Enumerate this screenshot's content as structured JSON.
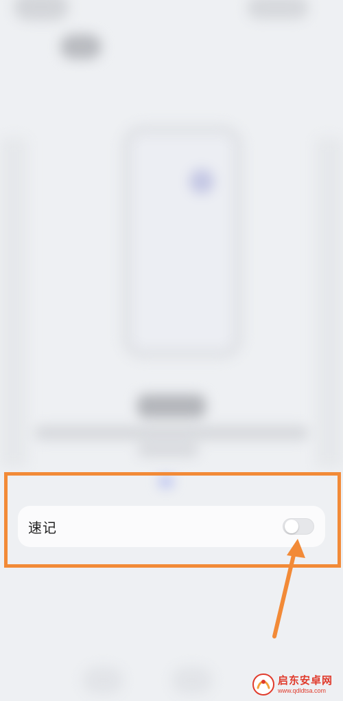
{
  "setting": {
    "label": "速记",
    "toggle_on": false
  },
  "watermark": {
    "name": "启东安卓网",
    "url": "www.qdldtsa.com"
  },
  "colors": {
    "highlight": "#f28a37",
    "toggle_track": "#e6e7ea",
    "card_bg": "#fbfbfc",
    "page_bg": "#eef0f3"
  },
  "icons": {
    "toggle": "toggle-switch-icon",
    "arrow": "annotation-arrow-icon",
    "logo": "watermark-logo-icon"
  }
}
